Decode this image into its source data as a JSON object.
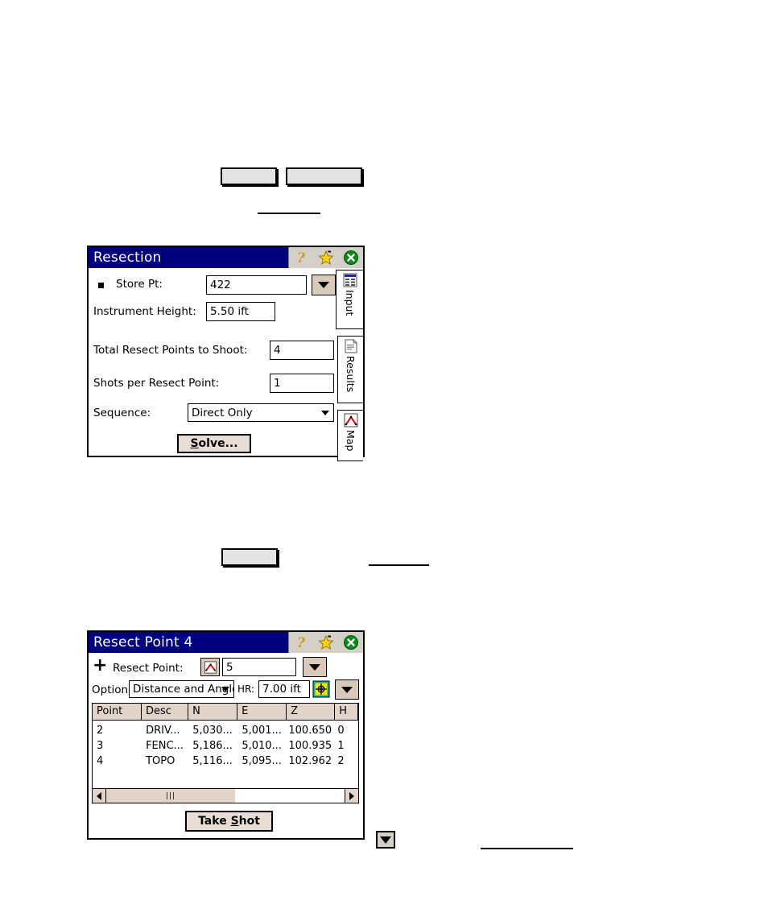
{
  "page": {
    "background": "#ffffff",
    "placeholder_buttons": [
      {
        "name": "doc-button-1",
        "label": ""
      },
      {
        "name": "doc-button-2",
        "label": ""
      },
      {
        "name": "doc-button-3",
        "label": ""
      }
    ],
    "dropdown_glyph": "▼"
  },
  "dialog_resection": {
    "title": "Resection",
    "titlebar_color": "#00007e",
    "titlebar_icons": [
      {
        "name": "help-icon",
        "glyph": "?",
        "color": "#d4a017"
      },
      {
        "name": "favorites-star-icon",
        "glyph": "★",
        "color": "#ffd700"
      },
      {
        "name": "close-icon",
        "glyph": "✕",
        "color": "#008000"
      }
    ],
    "fields": {
      "store_pt_label": "Store Pt:",
      "store_pt_value": "422",
      "instrument_height_label": "Instrument Height:",
      "instrument_height_value": "5.50 ift",
      "total_resect_points_label": "Total Resect Points to Shoot:",
      "total_resect_points_value": "4",
      "shots_per_point_label": "Shots per Resect Point:",
      "shots_per_point_value": "1",
      "sequence_label": "Sequence:",
      "sequence_value": "Direct Only",
      "sequence_options": [
        "Direct Only"
      ]
    },
    "solve_button": "Solve...",
    "tabs": [
      {
        "name": "tab-input",
        "label": "Input",
        "selected": true,
        "icon": "input-form-icon"
      },
      {
        "name": "tab-results",
        "label": "Results",
        "selected": false,
        "icon": "document-icon"
      },
      {
        "name": "tab-map",
        "label": "Map",
        "selected": false,
        "icon": "map-points-icon"
      }
    ]
  },
  "dialog_resect_point": {
    "title": "Resect Point 4",
    "titlebar_color": "#00007e",
    "titlebar_icons": [
      {
        "name": "help-icon",
        "glyph": "?",
        "color": "#d4a017"
      },
      {
        "name": "favorites-star-icon",
        "glyph": "★",
        "color": "#ffd700"
      },
      {
        "name": "close-icon",
        "glyph": "✕",
        "color": "#008000"
      }
    ],
    "resect_point_label": "Resect Point:",
    "resect_point_value": "5",
    "option_label": "Option:",
    "option_value": "Distance and Angle",
    "option_options": [
      "Distance and Angle"
    ],
    "hr_label": "HR:",
    "hr_value": "7.00 ift",
    "take_shot_button": "Take Shot",
    "table": {
      "columns": [
        "Point",
        "Desc",
        "N",
        "E",
        "Z",
        "H"
      ],
      "rows": [
        [
          "2",
          "DRIV...",
          "5,030...",
          "5,001...",
          "100.650",
          "0"
        ],
        [
          "3",
          "FENC...",
          "5,186...",
          "5,010...",
          "100.935",
          "1"
        ],
        [
          "4",
          "TOPO",
          "5,116...",
          "5,095...",
          "102.962",
          "2"
        ]
      ]
    },
    "scrollbar": {
      "left_arrow": "◀",
      "right_arrow": "▶",
      "grip": "|||"
    }
  }
}
